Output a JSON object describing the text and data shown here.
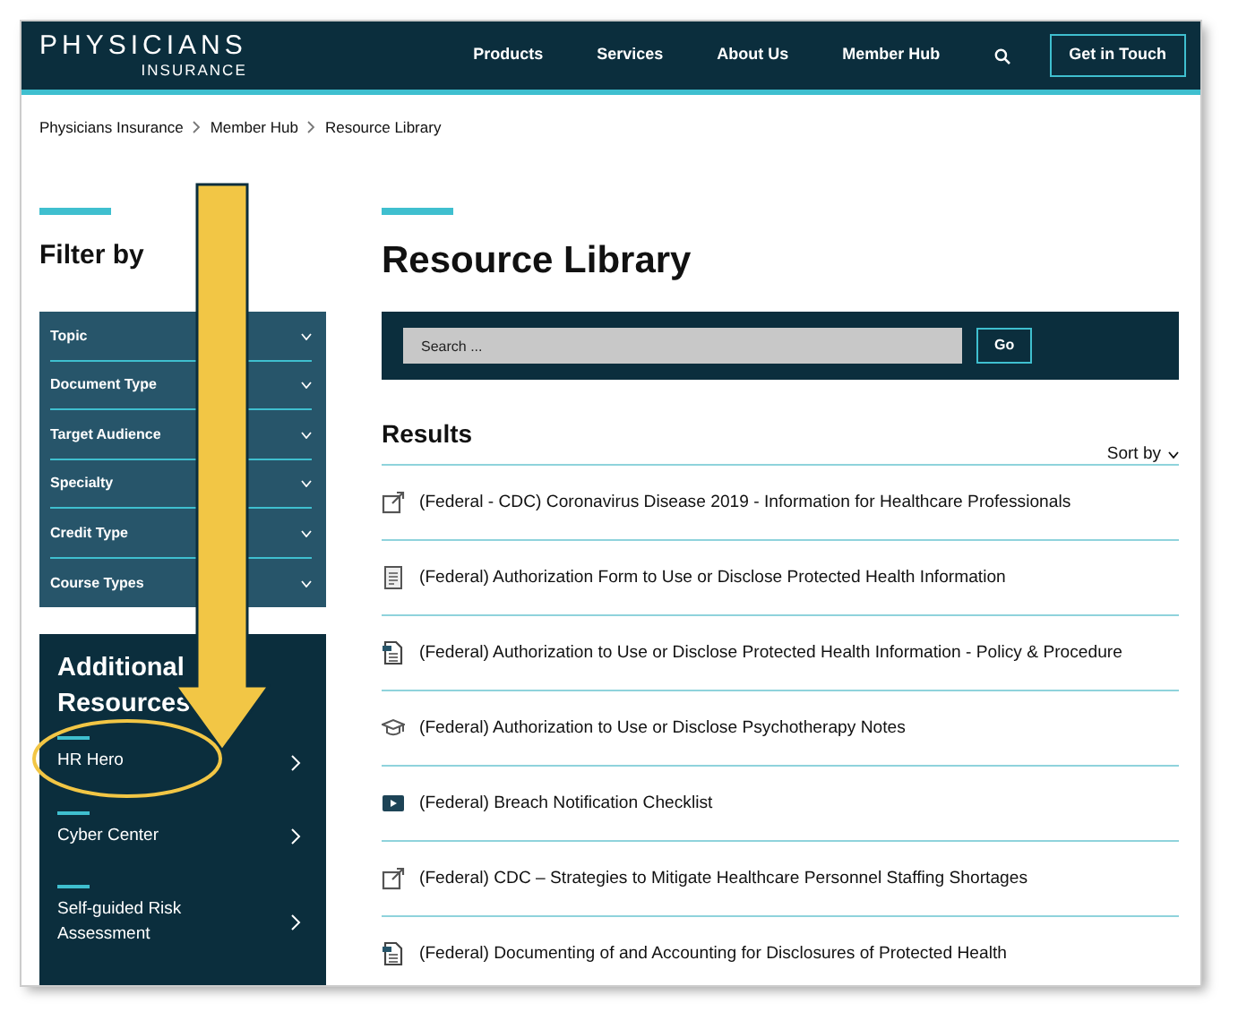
{
  "header": {
    "logo": {
      "name": "PHYSICIANS",
      "sub": "INSURANCE"
    },
    "nav": [
      "Products",
      "Services",
      "About Us",
      "Member Hub"
    ],
    "cta": "Get in Touch"
  },
  "breadcrumb": [
    "Physicians Insurance",
    "Member Hub",
    "Resource Library"
  ],
  "filter": {
    "title": "Filter by",
    "items": [
      {
        "label": "Topic",
        "expanded": false
      },
      {
        "label": "Document Type",
        "expanded": false
      },
      {
        "label": "Target Audience",
        "expanded": false
      },
      {
        "label": "Specialty",
        "expanded": false
      },
      {
        "label": "Credit Type",
        "expanded": false
      },
      {
        "label": "Course Types",
        "expanded": false
      }
    ]
  },
  "additional_resources": {
    "title": "Additional Resources",
    "items": [
      {
        "label": "HR Hero",
        "highlighted": true
      },
      {
        "label": "Cyber Center",
        "highlighted": false
      },
      {
        "label": "Self-guided Risk Assessment",
        "highlighted": false
      }
    ]
  },
  "main": {
    "title": "Resource Library",
    "search": {
      "placeholder": "Search ...",
      "button": "Go"
    },
    "results_title": "Results",
    "sort": "Sort by",
    "results": [
      {
        "kind": "link",
        "title": "(Federal - CDC) Coronavirus Disease 2019 - Information for Healthcare Professionals"
      },
      {
        "kind": "form",
        "title": "(Federal) Authorization Form to Use or Disclose Protected Health Information"
      },
      {
        "kind": "document",
        "title": "(Federal) Authorization to Use or Disclose Protected Health Information - Policy & Procedure"
      },
      {
        "kind": "course",
        "title": "(Federal) Authorization to Use or Disclose Psychotherapy Notes"
      },
      {
        "kind": "video",
        "title": "(Federal) Breach Notification Checklist"
      },
      {
        "kind": "link",
        "title": "(Federal) CDC – Strategies to Mitigate Healthcare Personnel Staffing Shortages"
      },
      {
        "kind": "document",
        "title": "(Federal) Documenting of and Accounting for Disclosures of Protected Health"
      }
    ]
  }
}
